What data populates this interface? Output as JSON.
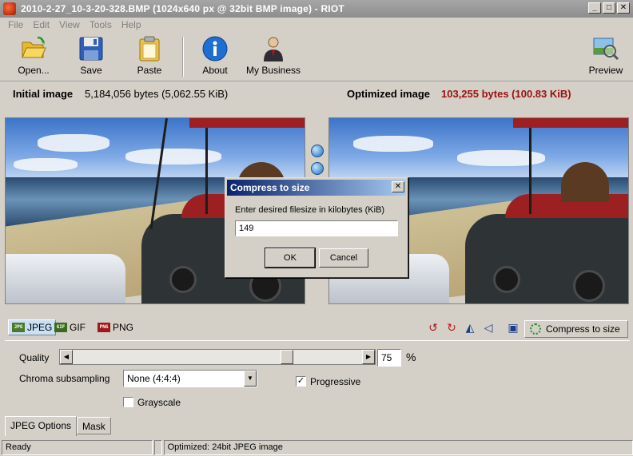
{
  "window": {
    "title": "2010-2-27_10-3-20-328.BMP (1024x640 px @ 32bit BMP image) - RIOT",
    "controls": {
      "minimize": "_",
      "maximize": "□",
      "close": "✕"
    }
  },
  "menu": [
    "File",
    "Edit",
    "View",
    "Tools",
    "Help"
  ],
  "toolbar": {
    "open": "Open...",
    "save": "Save",
    "paste": "Paste",
    "about": "About",
    "my_business": "My Business",
    "preview": "Preview"
  },
  "info": {
    "initial_label": "Initial image",
    "initial_value": "5,184,056 bytes (5,062.55 KiB)",
    "optimized_label": "Optimized image",
    "optimized_value": "103,255 bytes (100.83 KiB)",
    "optimized_color": "#9a1010"
  },
  "formats": {
    "jpeg": {
      "badge": "JPG",
      "label": "JPEG"
    },
    "gif": {
      "badge": "GIF",
      "label": "GIF"
    },
    "png": {
      "badge": "PNG",
      "label": "PNG"
    }
  },
  "compress_button": "Compress to size",
  "options": {
    "quality_label": "Quality",
    "quality_value": "75",
    "quality_fraction": 0.75,
    "percent_sign": "%",
    "chroma_label": "Chroma subsampling",
    "chroma_value": "None (4:4:4)",
    "progressive_label": "Progressive",
    "progressive_checked": true,
    "grayscale_label": "Grayscale",
    "grayscale_checked": false
  },
  "tabs": [
    "JPEG Options",
    "Mask"
  ],
  "status": {
    "left": "Ready",
    "middle": "",
    "right": "Optimized: 24bit JPEG image"
  },
  "dialog": {
    "title": "Compress to size",
    "close": "✕",
    "prompt": "Enter desired filesize in kilobytes (KiB)",
    "value": "149",
    "ok": "OK",
    "cancel": "Cancel"
  }
}
